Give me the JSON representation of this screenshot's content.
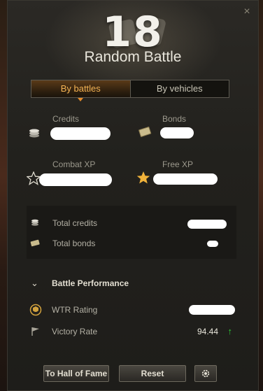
{
  "header": {
    "battles_count": "18",
    "title": "Random Battle",
    "close_label": "×"
  },
  "tabs": [
    {
      "label": "By battles",
      "active": true
    },
    {
      "label": "By vehicles",
      "active": false
    }
  ],
  "stats": {
    "credits_label": "Credits",
    "bonds_label": "Bonds",
    "combat_xp_label": "Combat XP",
    "free_xp_label": "Free XP"
  },
  "summary": {
    "total_credits_label": "Total credits",
    "total_bonds_label": "Total bonds"
  },
  "performance": {
    "section_title": "Battle Performance",
    "wtr_label": "WTR Rating",
    "victory_label": "Victory Rate",
    "victory_value": "94.44"
  },
  "footer": {
    "hall_of_fame_label": "To Hall of Fame",
    "reset_label": "Reset"
  },
  "colors": {
    "accent": "#f4b354",
    "up_trend": "#2fcf37"
  }
}
